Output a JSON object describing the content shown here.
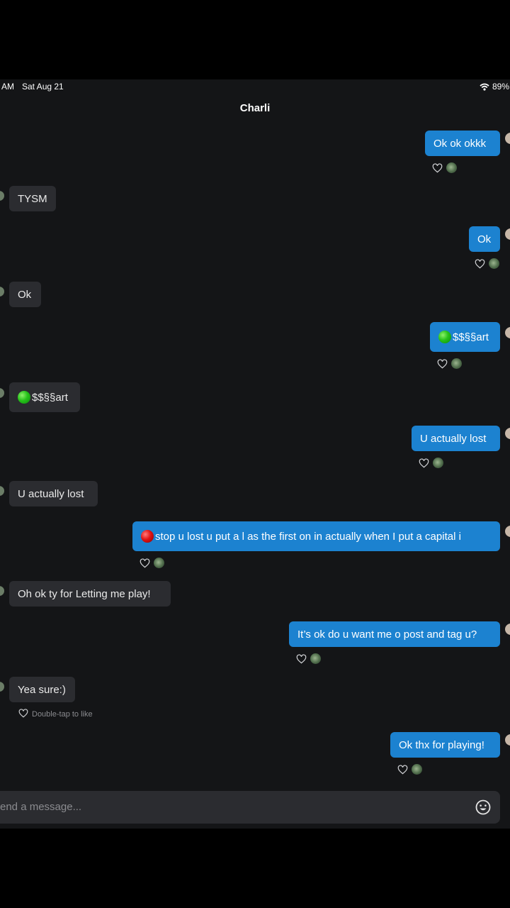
{
  "status": {
    "time": "AM",
    "date": "Sat Aug 21",
    "battery": "89%"
  },
  "header": {
    "title": "Charli"
  },
  "messages": [
    {
      "side": "sent",
      "text": "Ok ok okkk"
    },
    {
      "side": "recv",
      "text": "TYSM"
    },
    {
      "side": "sent",
      "text": "Ok"
    },
    {
      "side": "recv",
      "text": "Ok"
    },
    {
      "side": "sent",
      "dot": "green",
      "text": "$$§§art"
    },
    {
      "side": "recv",
      "dot": "green",
      "text": "$$§§art"
    },
    {
      "side": "sent",
      "text": "U actually lost"
    },
    {
      "side": "recv",
      "text": "U actually lost"
    },
    {
      "side": "sent",
      "dot": "red",
      "text": "stop u lost u put a l as the first on in actually when I put a capital i"
    },
    {
      "side": "recv",
      "text": "Oh ok ty for Letting me play!"
    },
    {
      "side": "sent",
      "text": "It’s ok do u want me o post and tag u?"
    },
    {
      "side": "recv",
      "text": "Yea sure:)"
    },
    {
      "side": "sent",
      "text": "Ok thx for playing!"
    }
  ],
  "hint": "Double-tap to like",
  "composer": {
    "placeholder": "end a message..."
  },
  "icons": {
    "wifi": "wifi-icon",
    "heart": "heart-icon",
    "emoji": "emoji-icon"
  },
  "colors": {
    "sent_bubble": "#1c82d0",
    "recv_bubble": "#2b2c30",
    "background": "#141517"
  }
}
